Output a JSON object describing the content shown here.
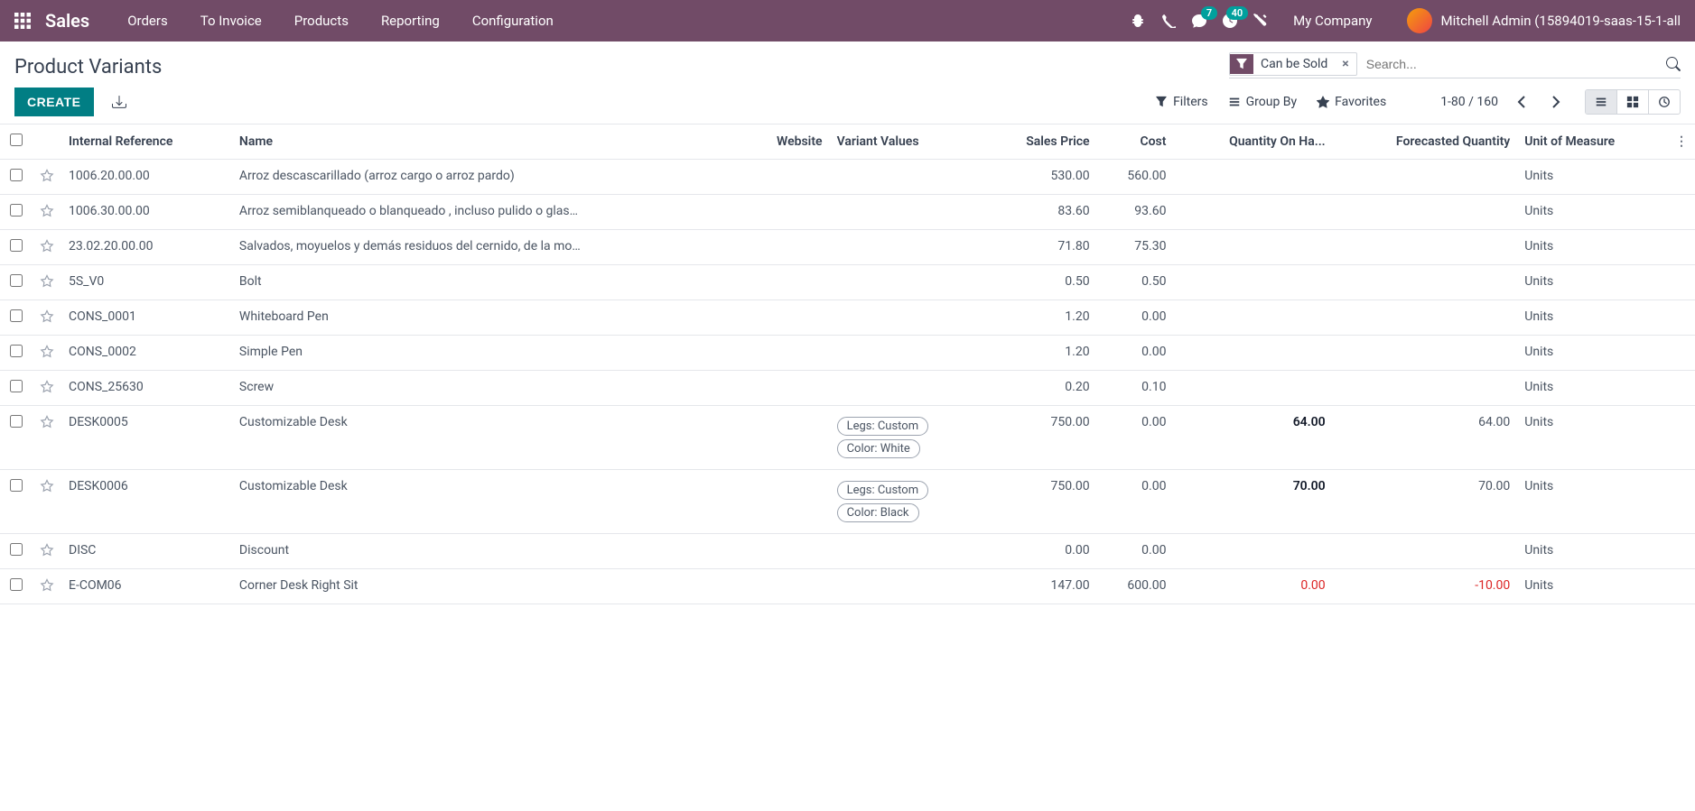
{
  "navbar": {
    "brand": "Sales",
    "links": [
      "Orders",
      "To Invoice",
      "Products",
      "Reporting",
      "Configuration"
    ],
    "messages_badge": "7",
    "activities_badge": "40",
    "company": "My Company",
    "user": "Mitchell Admin (15894019-saas-15-1-all"
  },
  "control_panel": {
    "title": "Product Variants",
    "search_facet": "Can be Sold",
    "search_placeholder": "Search...",
    "create_label": "CREATE",
    "filters_label": "Filters",
    "groupby_label": "Group By",
    "favorites_label": "Favorites",
    "pager": "1-80 / 160"
  },
  "columns": {
    "internal_ref": "Internal Reference",
    "name": "Name",
    "website": "Website",
    "variant_values": "Variant Values",
    "sales_price": "Sales Price",
    "cost": "Cost",
    "qty_on_hand": "Quantity On Ha...",
    "forecasted": "Forecasted Quantity",
    "uom": "Unit of Measure"
  },
  "rows": [
    {
      "ref": "1006.20.00.00",
      "name": "Arroz descascarillado (arroz cargo o arroz pardo)",
      "variants": [],
      "price": "530.00",
      "cost": "560.00",
      "qty": "",
      "forecast": "",
      "uom": "Units"
    },
    {
      "ref": "1006.30.00.00",
      "name": "Arroz semiblanqueado o blanqueado , incluso pulido o glas…",
      "variants": [],
      "price": "83.60",
      "cost": "93.60",
      "qty": "",
      "forecast": "",
      "uom": "Units"
    },
    {
      "ref": "23.02.20.00.00",
      "name": "Salvados, moyuelos y demás residuos del cernido, de la mo…",
      "variants": [],
      "price": "71.80",
      "cost": "75.30",
      "qty": "",
      "forecast": "",
      "uom": "Units"
    },
    {
      "ref": "5S_V0",
      "name": "Bolt",
      "variants": [],
      "price": "0.50",
      "cost": "0.50",
      "qty": "",
      "forecast": "",
      "uom": "Units"
    },
    {
      "ref": "CONS_0001",
      "name": "Whiteboard Pen",
      "variants": [],
      "price": "1.20",
      "cost": "0.00",
      "qty": "",
      "forecast": "",
      "uom": "Units"
    },
    {
      "ref": "CONS_0002",
      "name": "Simple Pen",
      "variants": [],
      "price": "1.20",
      "cost": "0.00",
      "qty": "",
      "forecast": "",
      "uom": "Units"
    },
    {
      "ref": "CONS_25630",
      "name": "Screw",
      "variants": [],
      "price": "0.20",
      "cost": "0.10",
      "qty": "",
      "forecast": "",
      "uom": "Units"
    },
    {
      "ref": "DESK0005",
      "name": "Customizable Desk",
      "variants": [
        "Legs: Custom",
        "Color: White"
      ],
      "price": "750.00",
      "cost": "0.00",
      "qty": "64.00",
      "qty_bold": true,
      "forecast": "64.00",
      "uom": "Units"
    },
    {
      "ref": "DESK0006",
      "name": "Customizable Desk",
      "variants": [
        "Legs: Custom",
        "Color: Black"
      ],
      "price": "750.00",
      "cost": "0.00",
      "qty": "70.00",
      "qty_bold": true,
      "forecast": "70.00",
      "uom": "Units"
    },
    {
      "ref": "DISC",
      "name": "Discount",
      "variants": [],
      "price": "0.00",
      "cost": "0.00",
      "qty": "",
      "forecast": "",
      "uom": "Units"
    },
    {
      "ref": "E-COM06",
      "name": "Corner Desk Right Sit",
      "variants": [],
      "price": "147.00",
      "cost": "600.00",
      "qty": "0.00",
      "qty_danger": true,
      "forecast": "-10.00",
      "forecast_danger": true,
      "uom": "Units"
    }
  ]
}
